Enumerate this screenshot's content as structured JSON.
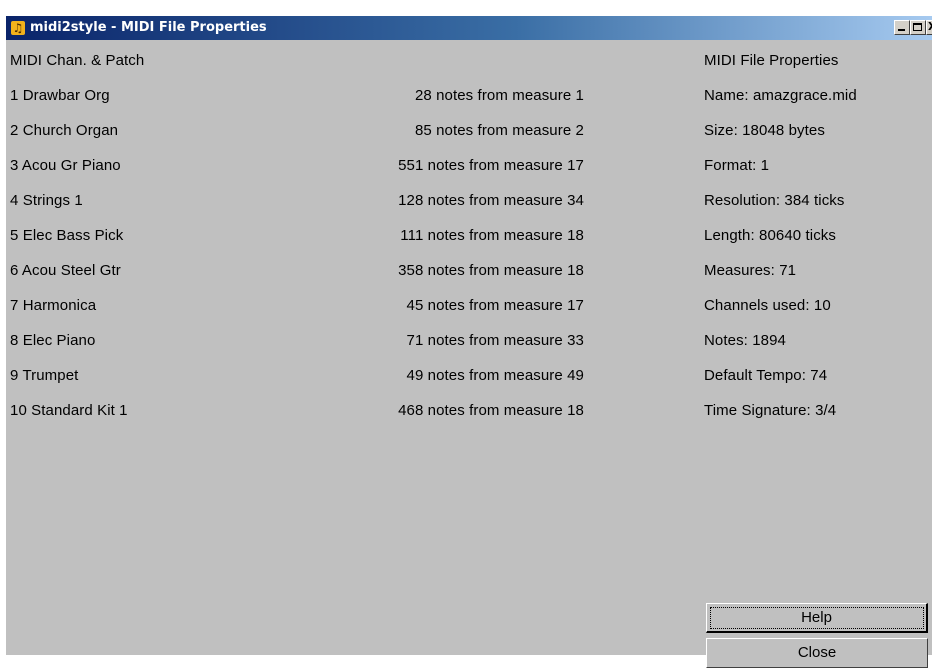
{
  "window": {
    "title": "midi2style - MIDI File Properties",
    "icon": "music-note-icon",
    "titlebar_colors": [
      "#0a246a",
      "#3a6ea5",
      "#a6caf0"
    ]
  },
  "channels": {
    "header": "MIDI Chan. & Patch",
    "rows": [
      {
        "patch": "1 Drawbar Org",
        "notes": "28 notes from measure 1"
      },
      {
        "patch": "2 Church Organ",
        "notes": "85 notes from measure 2"
      },
      {
        "patch": "3 Acou Gr Piano",
        "notes": "551 notes from measure 17"
      },
      {
        "patch": "4 Strings 1",
        "notes": "128 notes from measure 34"
      },
      {
        "patch": "5 Elec Bass Pick",
        "notes": "111 notes from measure 18"
      },
      {
        "patch": "6 Acou Steel Gtr",
        "notes": "358 notes from measure 18"
      },
      {
        "patch": "7 Harmonica",
        "notes": "45 notes from measure 17"
      },
      {
        "patch": "8 Elec Piano",
        "notes": "71 notes from measure 33"
      },
      {
        "patch": "9 Trumpet",
        "notes": "49 notes from measure 49"
      },
      {
        "patch": "10 Standard Kit 1",
        "notes": "468 notes from measure 18"
      }
    ]
  },
  "properties": {
    "header": "MIDI File Properties",
    "items": [
      "Name: amazgrace.mid",
      "Size: 18048 bytes",
      "Format: 1",
      "Resolution: 384 ticks",
      "Length: 80640 ticks",
      "Measures: 71",
      "Channels used: 10",
      "Notes: 1894",
      "Default Tempo: 74",
      "Time Signature: 3/4"
    ]
  },
  "buttons": {
    "help": "Help",
    "close": "Close"
  }
}
